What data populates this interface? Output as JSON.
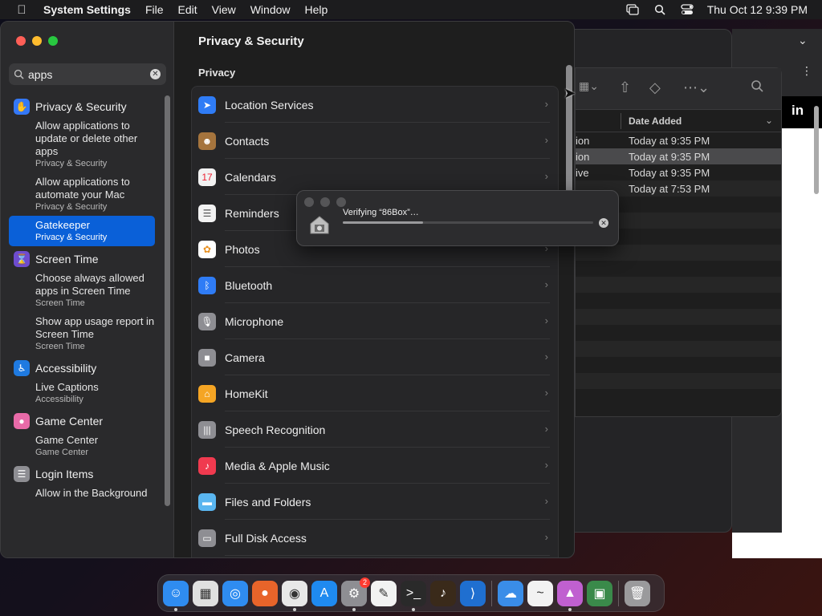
{
  "menubar": {
    "app_name": "System Settings",
    "menus": [
      "File",
      "Edit",
      "View",
      "Window",
      "Help"
    ],
    "clock": "Thu Oct 12  9:39 PM",
    "tray_icons": [
      "screen-mirroring-icon",
      "spotlight-search-icon",
      "control-center-icon"
    ]
  },
  "search": {
    "value": "apps"
  },
  "sidebar": {
    "sections": [
      {
        "title": "Privacy & Security",
        "icon": "hand-icon",
        "color": "#3478f6",
        "results": [
          {
            "main": "Allow applications to update or delete other apps",
            "sub": "Privacy & Security",
            "selected": false
          },
          {
            "main": "Allow applications to automate your Mac",
            "sub": "Privacy & Security",
            "selected": false
          },
          {
            "main": "Gatekeeper",
            "sub": "Privacy & Security",
            "selected": true
          }
        ]
      },
      {
        "title": "Screen Time",
        "icon": "hourglass-icon",
        "color": "#6e4ccf",
        "results": [
          {
            "main": "Choose always allowed apps in Screen Time",
            "sub": "Screen Time",
            "selected": false
          },
          {
            "main": "Show app usage report in Screen Time",
            "sub": "Screen Time",
            "selected": false
          }
        ]
      },
      {
        "title": "Accessibility",
        "icon": "accessibility-icon",
        "color": "#1f7ae0",
        "results": [
          {
            "main": "Live Captions",
            "sub": "Accessibility",
            "selected": false
          }
        ]
      },
      {
        "title": "Game Center",
        "icon": "game-center-icon",
        "color": "#e86aa8",
        "results": [
          {
            "main": "Game Center",
            "sub": "Game Center",
            "selected": false
          }
        ]
      },
      {
        "title": "Login Items",
        "icon": "list-icon",
        "color": "#8e8e93",
        "results": [
          {
            "main": "Allow in the Background",
            "sub": "",
            "selected": false
          }
        ]
      }
    ]
  },
  "content": {
    "title": "Privacy & Security",
    "subheading": "Privacy",
    "items": [
      {
        "label": "Location Services",
        "icon": "location-arrow-icon",
        "color": "#2f7cf6"
      },
      {
        "label": "Contacts",
        "icon": "contacts-icon",
        "color": "#a5743d"
      },
      {
        "label": "Calendars",
        "icon": "calendar-icon",
        "color": "#f2f2f2"
      },
      {
        "label": "Reminders",
        "icon": "reminders-icon",
        "color": "#f2f2f2"
      },
      {
        "label": "Photos",
        "icon": "photos-icon",
        "color": "#ffffff"
      },
      {
        "label": "Bluetooth",
        "icon": "bluetooth-icon",
        "color": "#2f7cf6"
      },
      {
        "label": "Microphone",
        "icon": "microphone-icon",
        "color": "#8e8e93"
      },
      {
        "label": "Camera",
        "icon": "camera-icon",
        "color": "#8e8e93"
      },
      {
        "label": "HomeKit",
        "icon": "home-icon",
        "color": "#f5a524"
      },
      {
        "label": "Speech Recognition",
        "icon": "waveform-icon",
        "color": "#8e8e93"
      },
      {
        "label": "Media & Apple Music",
        "icon": "music-note-icon",
        "color": "#f03a4f"
      },
      {
        "label": "Files and Folders",
        "icon": "folder-icon",
        "color": "#5ab6f0"
      },
      {
        "label": "Full Disk Access",
        "icon": "disk-icon",
        "color": "#8e8e93"
      }
    ]
  },
  "dialog": {
    "text": "Verifying “86Box”…",
    "progress": 0.32,
    "icon": "86box-app-icon"
  },
  "finder": {
    "column_header": "Date Added",
    "rows": [
      {
        "kind": "ion",
        "date": "Today at 9:35 PM",
        "selected": false
      },
      {
        "kind": "ion",
        "date": "Today at 9:35 PM",
        "selected": true
      },
      {
        "kind": "ive",
        "date": "Today at 9:35 PM",
        "selected": false
      },
      {
        "kind": "",
        "date": "Today at 7:53 PM",
        "selected": false
      },
      {
        "kind": "",
        "date": "",
        "selected": false
      },
      {
        "kind": "",
        "date": "",
        "selected": false
      },
      {
        "kind": "",
        "date": "",
        "selected": false
      },
      {
        "kind": "",
        "date": "",
        "selected": false
      },
      {
        "kind": "",
        "date": "",
        "selected": false
      },
      {
        "kind": "",
        "date": "",
        "selected": false
      },
      {
        "kind": "",
        "date": "",
        "selected": false
      },
      {
        "kind": "",
        "date": "",
        "selected": false
      },
      {
        "kind": "",
        "date": "",
        "selected": false
      },
      {
        "kind": "",
        "date": "",
        "selected": false
      },
      {
        "kind": "",
        "date": "",
        "selected": false
      },
      {
        "kind": "",
        "date": "",
        "selected": false
      },
      {
        "kind": "",
        "date": "",
        "selected": false
      }
    ],
    "right_page_text": "in"
  },
  "dock": {
    "apps": [
      {
        "name": "finder-icon",
        "color": "#2f8cf0",
        "glyph": "☺",
        "running": true
      },
      {
        "name": "launchpad-icon",
        "color": "#e0e0e0",
        "glyph": "▦",
        "running": false
      },
      {
        "name": "safari-icon",
        "color": "#2f8cf0",
        "glyph": "◎",
        "running": false
      },
      {
        "name": "firefox-icon",
        "color": "#e8642a",
        "glyph": "●",
        "running": false
      },
      {
        "name": "chrome-icon",
        "color": "#e8e8e8",
        "glyph": "◉",
        "running": true
      },
      {
        "name": "app-store-icon",
        "color": "#1f8af0",
        "glyph": "A",
        "running": false
      },
      {
        "name": "system-settings-icon",
        "color": "#8e8e93",
        "glyph": "⚙",
        "running": true,
        "badge": "2"
      },
      {
        "name": "textedit-icon",
        "color": "#f2f2f2",
        "glyph": "✎",
        "running": false
      },
      {
        "name": "terminal-icon",
        "color": "#2a2a2a",
        "glyph": ">_",
        "running": true
      },
      {
        "name": "garageband-icon",
        "color": "#3a2a1a",
        "glyph": "♪",
        "running": false
      },
      {
        "name": "vscode-icon",
        "color": "#1f6fd0",
        "glyph": "⟩",
        "running": false
      },
      {
        "name": "icloud-weather-icon",
        "color": "#3a8de8",
        "glyph": "☁",
        "running": false
      },
      {
        "name": "freeform-icon",
        "color": "#f2f2f2",
        "glyph": "~",
        "running": false
      },
      {
        "name": "gpu-monitor-icon",
        "color": "#c060d0",
        "glyph": "▲",
        "running": true
      },
      {
        "name": "86box-icon",
        "color": "#3a8a4a",
        "glyph": "▣",
        "running": false
      },
      {
        "name": "trash-icon",
        "color": "#9a9a9c",
        "glyph": "🗑",
        "running": false
      }
    ]
  }
}
